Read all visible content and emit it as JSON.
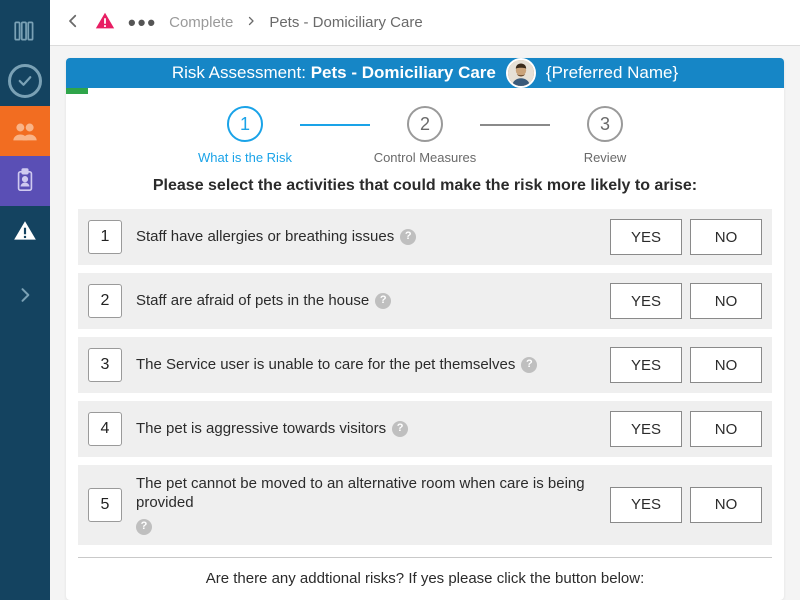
{
  "sidebar": {
    "items": [
      {
        "name": "books-icon"
      },
      {
        "name": "check-circle-icon"
      },
      {
        "name": "users-icon"
      },
      {
        "name": "id-badge-icon"
      },
      {
        "name": "alert-triangle-icon"
      },
      {
        "name": "chevron-right-icon"
      }
    ]
  },
  "topbar": {
    "breadcrumb": {
      "prev": "Complete",
      "current": "Pets - Domiciliary Care"
    }
  },
  "header": {
    "prefix": "Risk Assessment: ",
    "title": "Pets - Domiciliary Care",
    "preferred_name": "{Preferred Name}"
  },
  "stepper": {
    "steps": [
      {
        "num": "1",
        "label": "What is the Risk"
      },
      {
        "num": "2",
        "label": "Control Measures"
      },
      {
        "num": "3",
        "label": "Review"
      }
    ]
  },
  "prompt": "Please select the activities that could make the risk more likely to arise:",
  "buttons": {
    "yes": "YES",
    "no": "NO"
  },
  "questions": [
    {
      "num": "1",
      "text": "Staff have allergies or breathing issues"
    },
    {
      "num": "2",
      "text": "Staff are afraid of pets in the house"
    },
    {
      "num": "3",
      "text": "The Service user is unable to care for the pet themselves"
    },
    {
      "num": "4",
      "text": "The pet is aggressive towards visitors"
    },
    {
      "num": "5",
      "text": "The pet cannot be moved to an alternative room when care is being provided"
    }
  ],
  "additional_prompt": "Are there any addtional risks? If yes please click the button below:"
}
